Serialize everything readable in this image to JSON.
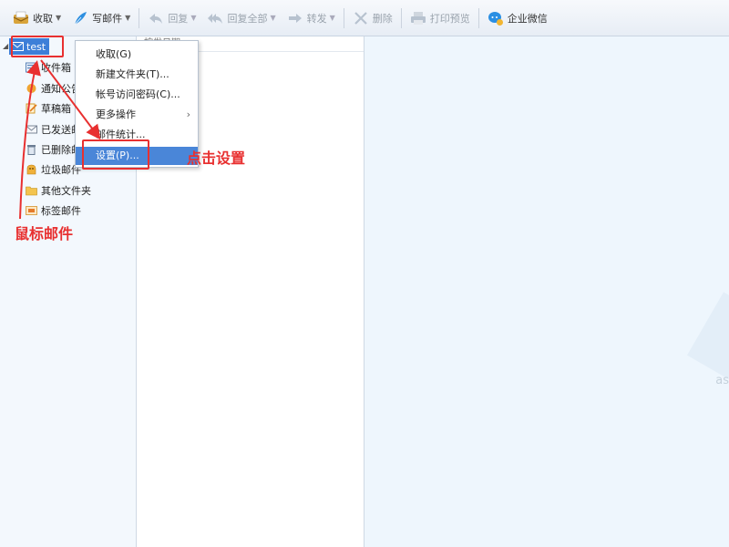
{
  "toolbar": {
    "items": [
      {
        "label": "收取",
        "icon": "inbox-icon",
        "caret": "▼",
        "enabled": true
      },
      {
        "label": "写邮件",
        "icon": "feather-icon",
        "caret": "▼",
        "enabled": true
      },
      {
        "label": "回复",
        "icon": "reply-icon",
        "caret": "▼",
        "enabled": false
      },
      {
        "label": "回复全部",
        "icon": "reply-all-icon",
        "caret": "▼",
        "enabled": false
      },
      {
        "label": "转发",
        "icon": "forward-icon",
        "caret": "▼",
        "enabled": false
      },
      {
        "label": "删除",
        "icon": "delete-icon",
        "enabled": false
      },
      {
        "label": "打印预览",
        "icon": "printer-icon",
        "enabled": false
      },
      {
        "label": "企业微信",
        "icon": "wecom-icon",
        "enabled": true
      }
    ]
  },
  "tree": {
    "account": "test",
    "folders": [
      "收件箱",
      "通知公告",
      "草稿箱",
      "已发送邮件",
      "已删除邮件",
      "垃圾邮件",
      "其他文件夹",
      "标签邮件"
    ]
  },
  "list_header": "按发日期",
  "context_menu": {
    "items": [
      {
        "label": "收取(G)"
      },
      {
        "label": "新建文件夹(T)..."
      },
      {
        "label": "帐号访问密码(C)..."
      },
      {
        "label": "更多操作",
        "submenu": "›"
      },
      {
        "label": "邮件统计..."
      },
      {
        "label": "设置(P)...",
        "highlighted": true
      }
    ]
  },
  "annotations": {
    "click_settings": "点击设置",
    "mouse_mail": "鼠标邮件"
  },
  "watermark": "as",
  "colors": {
    "accent": "#3d7fd8",
    "annotation": "#e83030",
    "toolbar_bg": "#e7edf5",
    "left_pane_bg": "#f3f8fd",
    "right_pane_bg": "#eef6fd"
  }
}
